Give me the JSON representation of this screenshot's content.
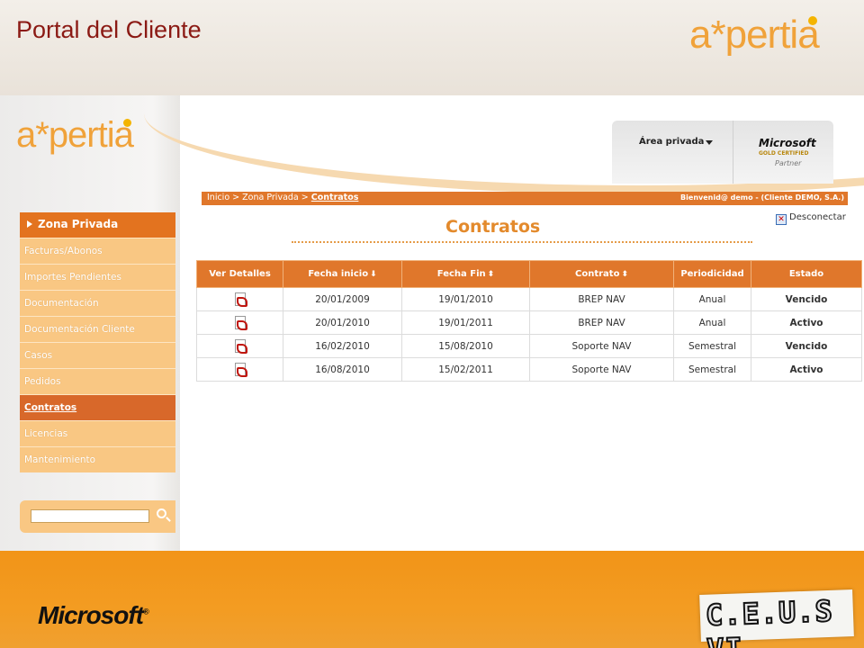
{
  "slide": {
    "title": "Portal del Cliente",
    "logo_text": "a*pertia",
    "bottom_left_logo": "Microsoft",
    "bottom_right_logo": "C.E.U.S VI"
  },
  "header": {
    "logo_text": "a*pertia",
    "area_label": "Área privada",
    "partner_badge": {
      "brand": "Microsoft",
      "level": "GOLD CERTIFIED",
      "type": "Partner"
    }
  },
  "breadcrumb": {
    "items": [
      "Inicio",
      "Zona Privada"
    ],
    "current": "Contratos",
    "welcome": "Bienvenid@ demo - (Cliente DEMO, S.A.)"
  },
  "page": {
    "title": "Contratos",
    "disconnect_label": "Desconectar"
  },
  "sidebar": {
    "heading": "Zona Privada",
    "items": [
      {
        "label": "Facturas/Abonos",
        "active": false
      },
      {
        "label": "Importes Pendientes",
        "active": false
      },
      {
        "label": "Documentación",
        "active": false
      },
      {
        "label": "Documentación Cliente",
        "active": false
      },
      {
        "label": "Casos",
        "active": false
      },
      {
        "label": "Pedidos",
        "active": false
      },
      {
        "label": "Contratos",
        "active": true
      },
      {
        "label": "Licencias",
        "active": false
      },
      {
        "label": "Mantenimiento",
        "active": false
      }
    ]
  },
  "search": {
    "value": "",
    "icon": "search-icon"
  },
  "table": {
    "columns": [
      {
        "label": "Ver Detalles",
        "sort": ""
      },
      {
        "label": "Fecha inicio",
        "sort": "down"
      },
      {
        "label": "Fecha Fin",
        "sort": "both"
      },
      {
        "label": "Contrato",
        "sort": "both"
      },
      {
        "label": "Periodicidad",
        "sort": ""
      },
      {
        "label": "Estado",
        "sort": ""
      }
    ],
    "rows": [
      {
        "start": "20/01/2009",
        "end": "19/01/2010",
        "contract": "BREP NAV",
        "period": "Anual",
        "status": "Vencido",
        "status_type": "expired"
      },
      {
        "start": "20/01/2010",
        "end": "19/01/2011",
        "contract": "BREP NAV",
        "period": "Anual",
        "status": "Activo",
        "status_type": "active"
      },
      {
        "start": "16/02/2010",
        "end": "15/08/2010",
        "contract": "Soporte NAV",
        "period": "Semestral",
        "status": "Vencido",
        "status_type": "expired"
      },
      {
        "start": "16/08/2010",
        "end": "15/02/2011",
        "contract": "Soporte NAV",
        "period": "Semestral",
        "status": "Activo",
        "status_type": "active"
      }
    ]
  },
  "colors": {
    "accent": "#e0772b",
    "sidebar_item": "#f9c783",
    "title_red": "#8b1a14",
    "expired": "#e00000",
    "active": "#22b322"
  }
}
